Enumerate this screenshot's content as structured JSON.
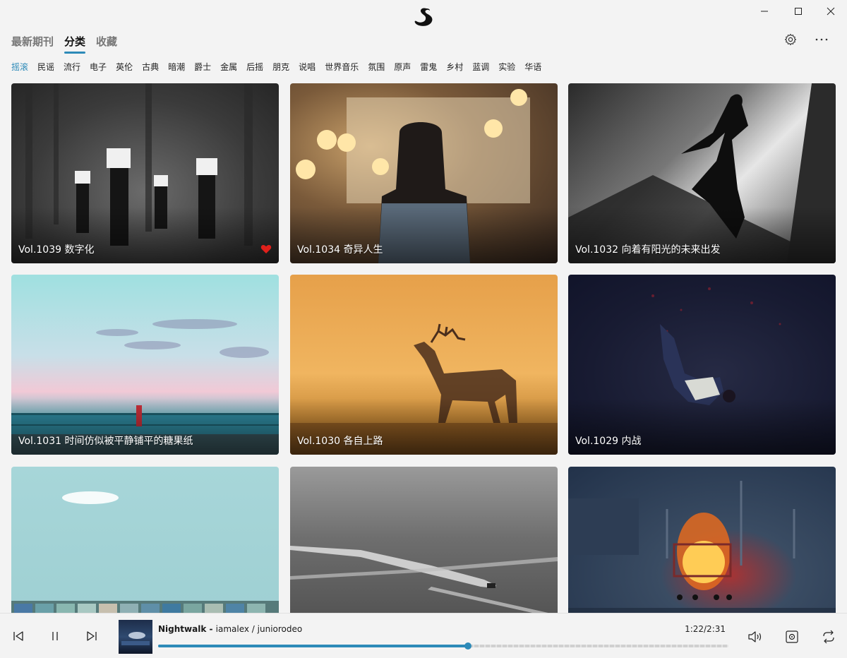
{
  "window": {
    "logo_icon": "swan-icon",
    "minimize_icon": "minimize-icon",
    "maximize_icon": "maximize-icon",
    "close_icon": "close-icon"
  },
  "tabs": [
    {
      "label": "最新期刊",
      "active": false
    },
    {
      "label": "分类",
      "active": true
    },
    {
      "label": "收藏",
      "active": false
    }
  ],
  "top_actions": {
    "settings_icon": "gear-icon",
    "more_icon": "more-icon"
  },
  "genres": [
    "摇滚",
    "民谣",
    "流行",
    "电子",
    "英伦",
    "古典",
    "暗潮",
    "爵士",
    "金属",
    "后摇",
    "朋克",
    "说唱",
    "世界音乐",
    "氛围",
    "原声",
    "雷鬼",
    "乡村",
    "蓝调",
    "实验",
    "华语"
  ],
  "active_genre": "摇滚",
  "cards": [
    {
      "title": "Vol.1039 数字化",
      "favorited": true
    },
    {
      "title": "Vol.1034 奇异人生",
      "favorited": false
    },
    {
      "title": "Vol.1032 向着有阳光的未来出发",
      "favorited": false
    },
    {
      "title": "Vol.1031 时间仿似被平静铺平的糖果纸",
      "favorited": false
    },
    {
      "title": "Vol.1030 各自上路",
      "favorited": false
    },
    {
      "title": "Vol.1029 内战",
      "favorited": false
    },
    {
      "title": "",
      "favorited": false
    },
    {
      "title": "",
      "favorited": false
    },
    {
      "title": "",
      "favorited": false
    }
  ],
  "player": {
    "song": "Nightwalk",
    "separator": " - ",
    "artists": "iamalex / juniorodeo",
    "time": "1:22/2:31",
    "progress": 0.543,
    "accent_color": "#2d8ab8",
    "icons": [
      "previous-icon",
      "pause-icon",
      "next-icon",
      "volume-icon",
      "play-mode-icon",
      "repeat-icon"
    ]
  }
}
